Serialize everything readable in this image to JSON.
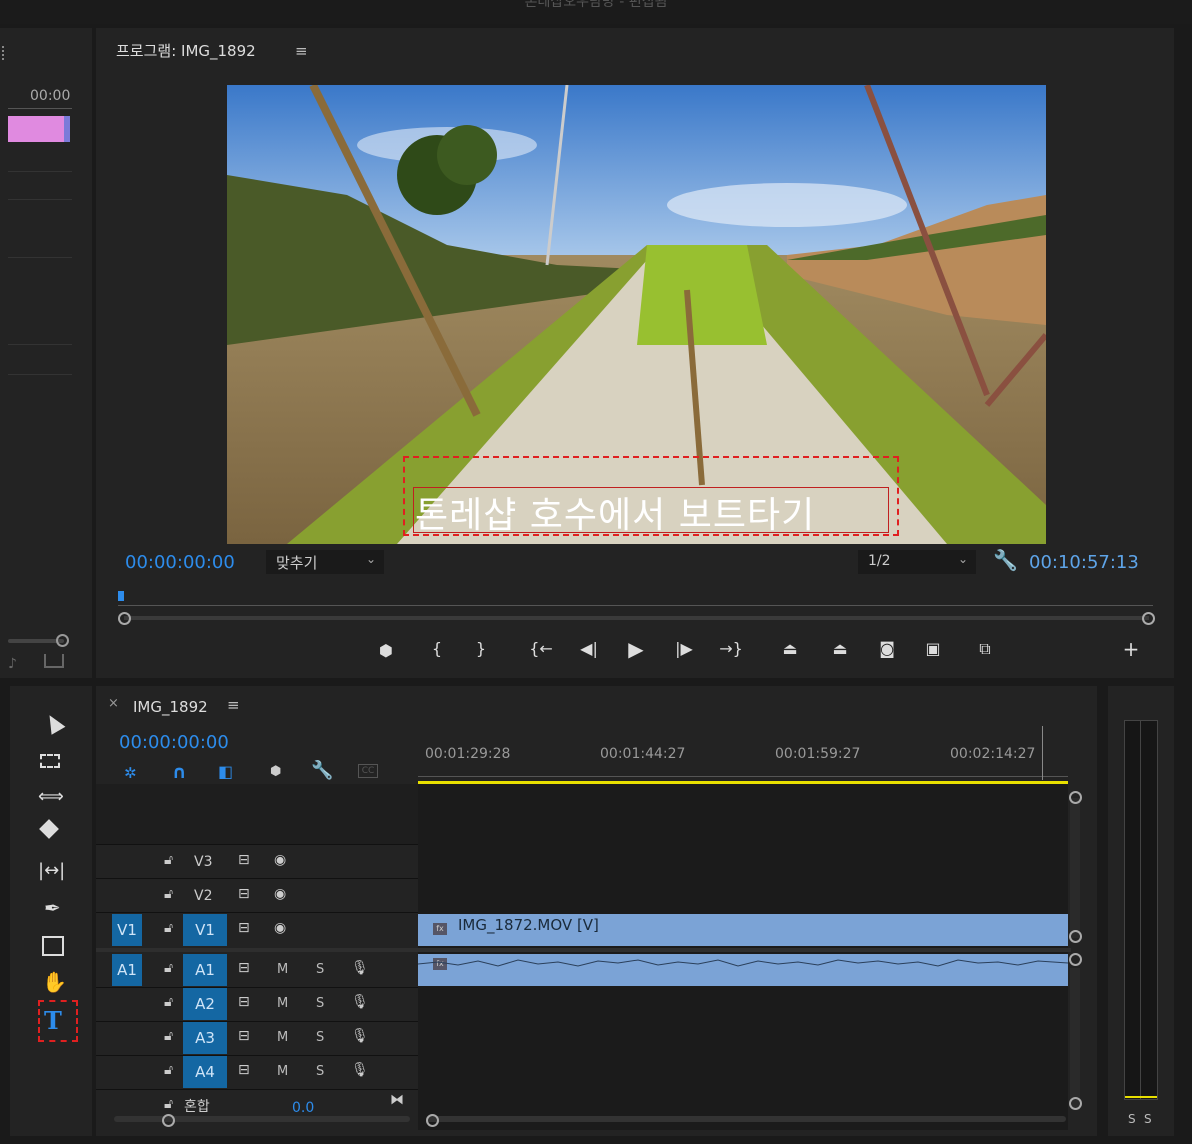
{
  "window": {
    "title": "톤레삽오우탐방 - 편집됨"
  },
  "source_panel": {
    "timecode": "00:00"
  },
  "program": {
    "title": "프로그램: IMG_1892",
    "menu_icon": "hamburger-icon",
    "caption": "톤레샵 호수에서 보트타기",
    "current_time": "00:00:00:00",
    "fit_label": "맞추기",
    "resolution": "1/2",
    "duration": "00:10:57:13",
    "colors": {
      "accent": "#2d8ceb",
      "caption_box": "#e02020"
    }
  },
  "transport": {
    "icons": [
      "marker-icon",
      "mark-in-icon",
      "mark-out-icon",
      "go-to-in-icon",
      "step-back-icon",
      "play-icon",
      "step-forward-icon",
      "go-to-out-icon",
      "lift-icon",
      "extract-icon",
      "camera-icon",
      "multi-camera-icon",
      "compare-icon",
      "add-icon"
    ]
  },
  "timeline": {
    "sequence_name": "IMG_1892",
    "current_time": "00:00:00:00",
    "ruler": [
      "00:01:29:28",
      "00:01:44:27",
      "00:01:59:27",
      "00:02:14:27"
    ],
    "video_tracks": [
      {
        "src": "",
        "name": "V3"
      },
      {
        "src": "",
        "name": "V2"
      },
      {
        "src": "V1",
        "name": "V1"
      }
    ],
    "audio_tracks": [
      {
        "src": "A1",
        "name": "A1",
        "m": "M",
        "s": "S"
      },
      {
        "src": "",
        "name": "A2",
        "m": "M",
        "s": "S"
      },
      {
        "src": "",
        "name": "A3",
        "m": "M",
        "s": "S"
      },
      {
        "src": "",
        "name": "A4",
        "m": "M",
        "s": "S"
      }
    ],
    "mix": {
      "label": "혼합",
      "value": "0.0"
    },
    "clip_label": "IMG_1872.MOV [V]",
    "colors": {
      "clip": "#7ba3d6",
      "work_area": "#e8e000"
    }
  },
  "meter": {
    "solo_left": "S",
    "solo_right": "S"
  },
  "tools": [
    "selection-tool-icon",
    "track-select-icon",
    "ripple-edit-icon",
    "razor-icon",
    "slip-icon",
    "pen-icon",
    "rectangle-icon",
    "hand-icon",
    "type-tool-icon"
  ]
}
